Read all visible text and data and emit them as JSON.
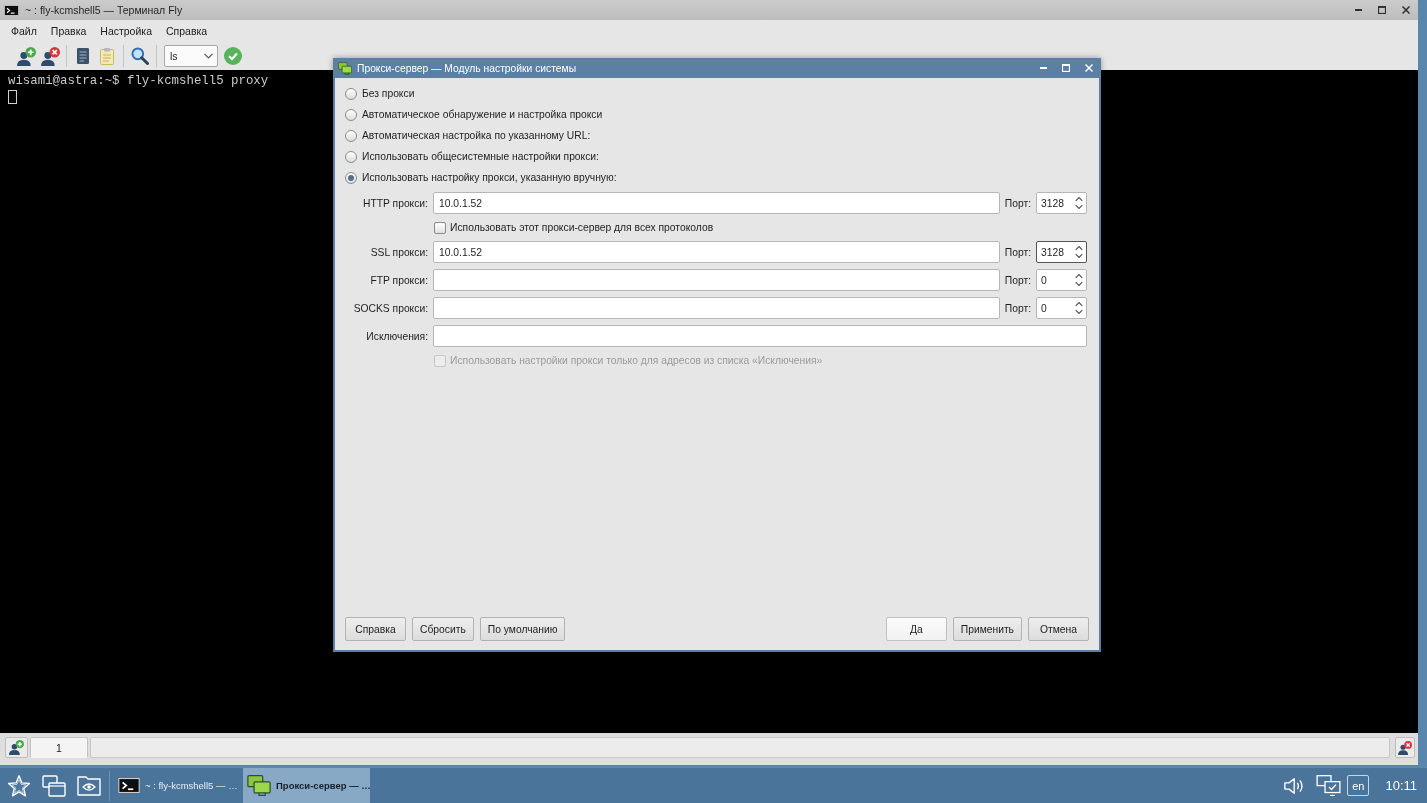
{
  "terminal_window": {
    "title": "~ : fly-kcmshell5 — Терминал Fly",
    "menu": [
      "Файл",
      "Правка",
      "Настройка",
      "Справка"
    ],
    "toolbar": {
      "command": "ls"
    },
    "lines": [
      "wisami@astra:~$ fly-kcmshell5 proxy"
    ],
    "tabs": [
      {
        "label": "1",
        "selected": true
      }
    ]
  },
  "dialog": {
    "title": "Прокси-сервер — Модуль настройки системы",
    "modes": [
      {
        "label": "Без прокси",
        "selected": false
      },
      {
        "label": "Автоматическое обнаружение и настройка прокси",
        "selected": false
      },
      {
        "label": "Автоматическая настройка по указанному URL:",
        "selected": false
      },
      {
        "label": "Использовать общесистемные настройки прокси:",
        "selected": false
      },
      {
        "label": "Использовать настройку прокси, указанную вручную:",
        "selected": true
      }
    ],
    "form_rows": [
      {
        "kind": "proxy",
        "label": "HTTP прокси:",
        "value": "10.0.1.52",
        "port_label": "Порт:",
        "port": "3128",
        "port_focused": false
      },
      {
        "kind": "checkbox",
        "label": "Использовать этот прокси-сервер для всех протоколов",
        "checked": false,
        "disabled": false
      },
      {
        "kind": "proxy",
        "label": "SSL прокси:",
        "value": "10.0.1.52",
        "port_label": "Порт:",
        "port": "3128",
        "port_focused": true
      },
      {
        "kind": "proxy",
        "label": "FTP прокси:",
        "port_label": "Порт:",
        "port": "0",
        "port_focused": false
      },
      {
        "kind": "proxy",
        "label": "SOCKS прокси:",
        "port_label": "Порт:",
        "port": "0",
        "port_focused": false
      },
      {
        "kind": "text",
        "label": "Исключения:"
      },
      {
        "kind": "checkbox",
        "label": "Использовать настройки прокси только для адресов из списка «Исключения»",
        "checked": false,
        "disabled": true
      }
    ],
    "buttons_left": [
      {
        "label": "Справка",
        "default": false
      },
      {
        "label": "Сбросить",
        "default": false
      },
      {
        "label": "По умолчанию",
        "default": false
      }
    ],
    "buttons_right": [
      {
        "label": "Да",
        "default": true
      },
      {
        "label": "Применить",
        "default": false
      },
      {
        "label": "Отмена",
        "default": false
      }
    ]
  },
  "taskbar": {
    "tasks": [
      {
        "kind": "terminal",
        "label": "~ : fly-kcmshell5 — …",
        "selected": false
      },
      {
        "kind": "settings",
        "label": "Прокси-сервер — …",
        "selected": true
      }
    ],
    "language": "en",
    "clock": "10:11"
  }
}
